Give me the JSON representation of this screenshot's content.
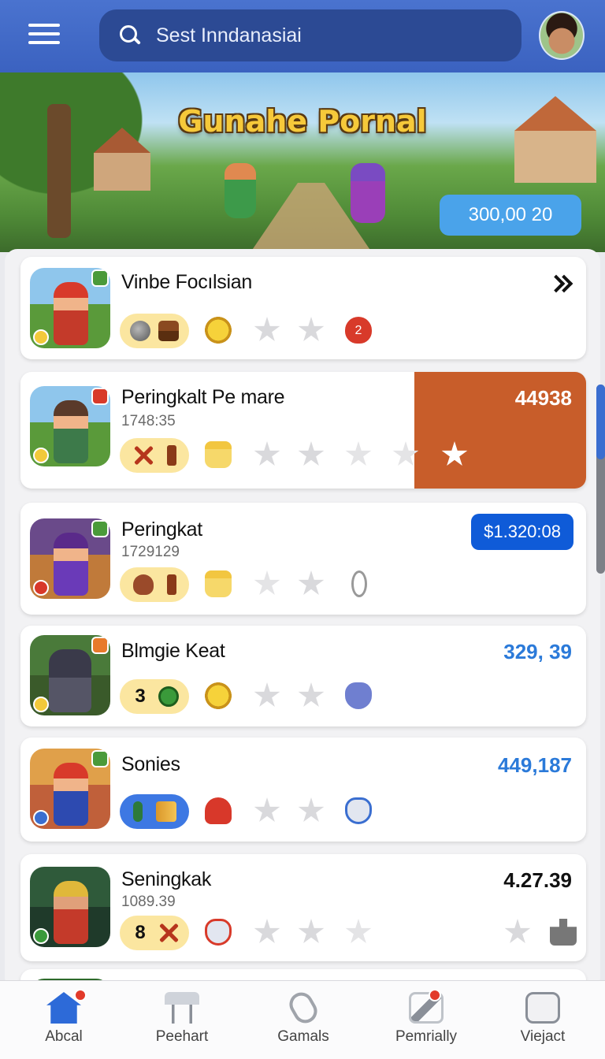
{
  "header": {
    "search_text": "Sest Inndanasiai"
  },
  "banner": {
    "title": "Gunahe Pornal",
    "amount": "300,00 20"
  },
  "items": [
    {
      "title": "Vinbe Focılsian",
      "sub": "",
      "amount": ""
    },
    {
      "title": "Peringkalt Pe mare",
      "sub": "1748:35",
      "amount": "44938"
    },
    {
      "title": "Peringkat",
      "sub": "1729129",
      "amount": "$1.320:08"
    },
    {
      "title": "Blmgie Keat",
      "sub": "",
      "amount": "329, 39",
      "pill_num": "3"
    },
    {
      "title": "Sonies",
      "sub": "",
      "amount": "449,187"
    },
    {
      "title": "Seningkak",
      "sub": "1089.39",
      "amount": "4.27.39",
      "pill_num": "8"
    }
  ],
  "nav": [
    {
      "label": "Abcal",
      "icon": "home-icon"
    },
    {
      "label": "Peehart",
      "icon": "table-icon"
    },
    {
      "label": "Gamals",
      "icon": "paperclip-icon"
    },
    {
      "label": "Pemrially",
      "icon": "pen-icon"
    },
    {
      "label": "Viejact",
      "icon": "dice-icon"
    }
  ],
  "colors": {
    "header": "#3b62c0",
    "accent_blue": "#2b7ad9",
    "orange": "#c85d2a",
    "pill_yellow": "#fbe6a0"
  }
}
